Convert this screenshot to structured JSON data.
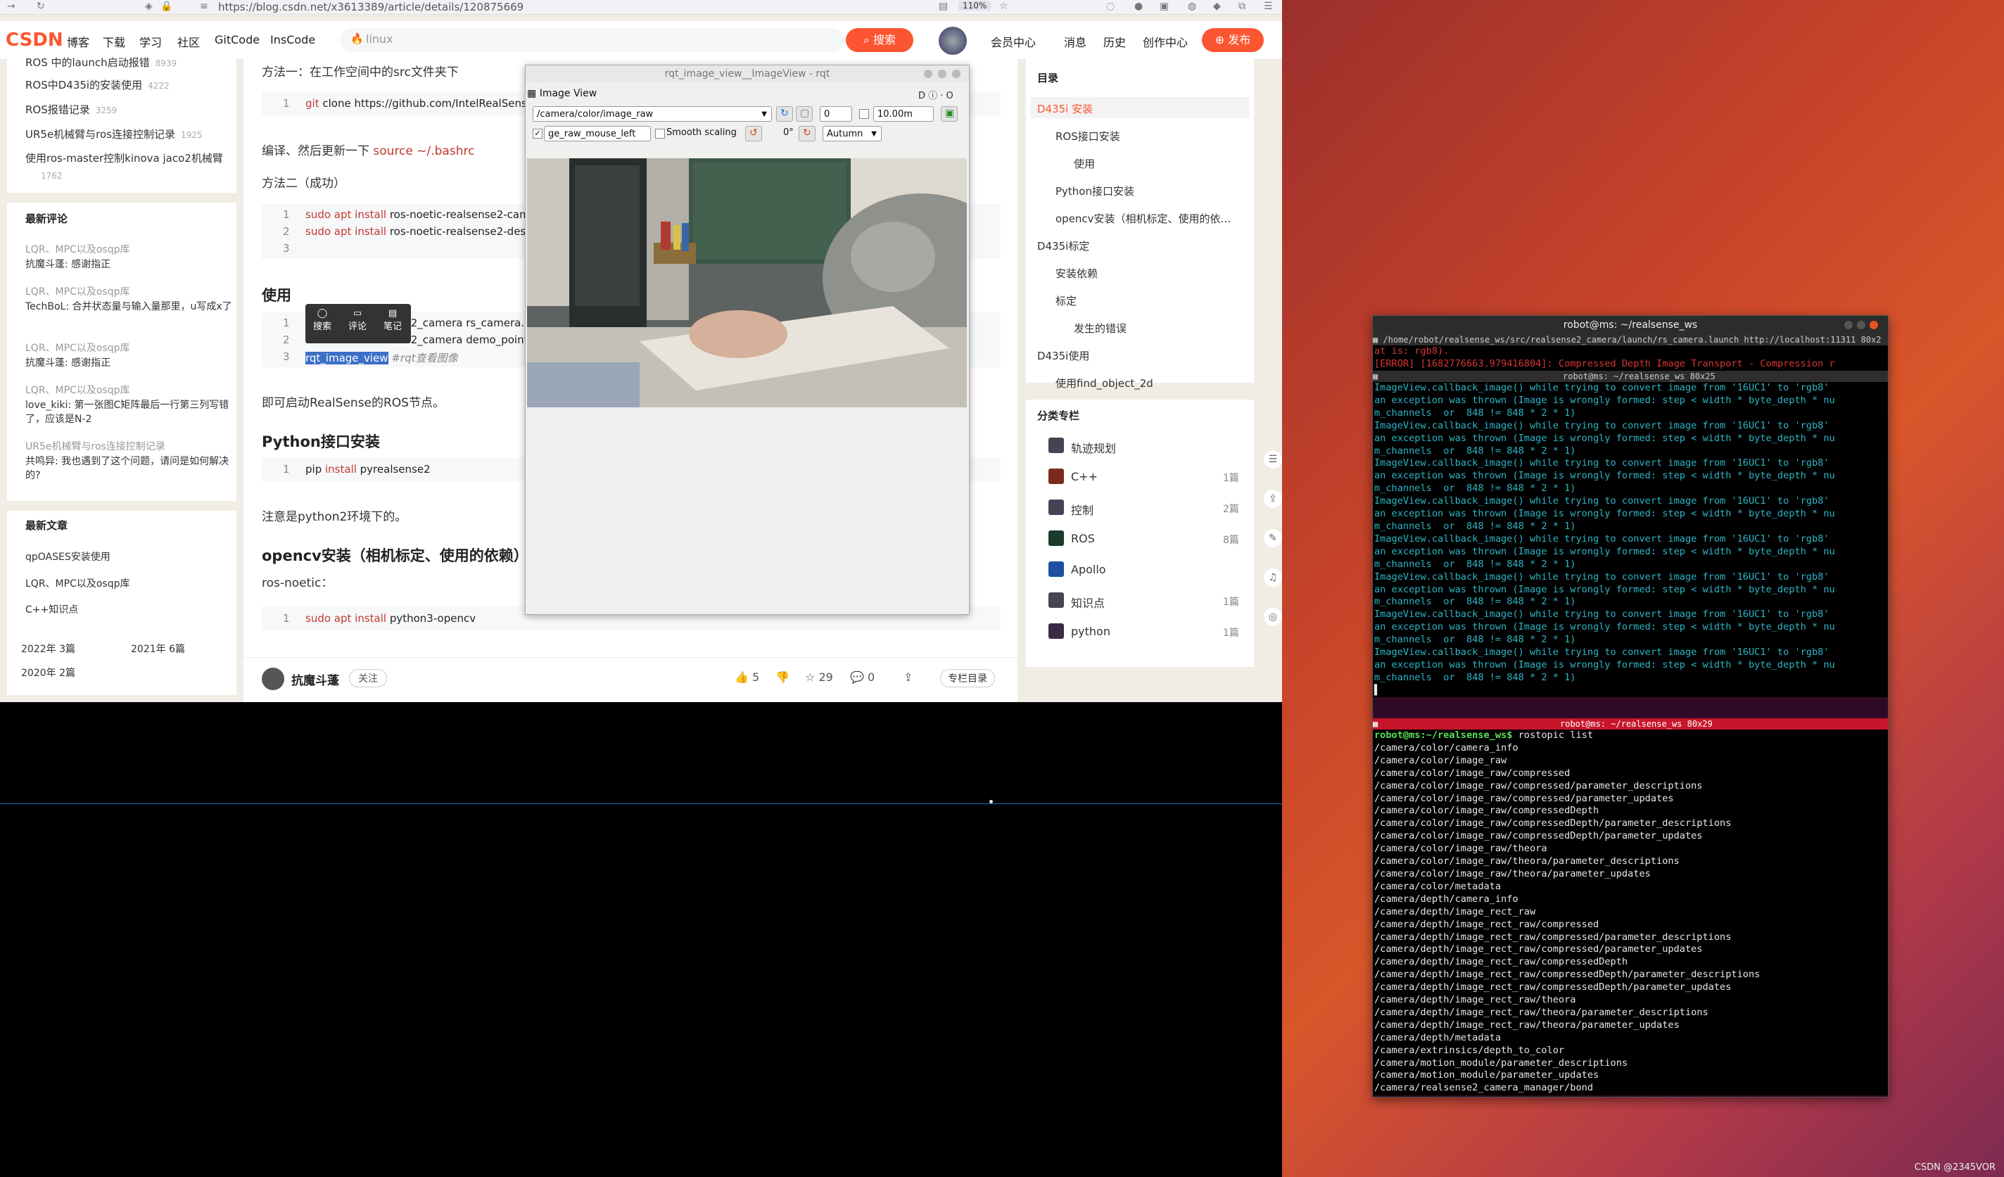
{
  "browser": {
    "url": "https://blog.csdn.net/x3613389/article/details/120875669",
    "zoom": "110%"
  },
  "csdn_nav": {
    "logo": "CSDN",
    "items": [
      "博客",
      "下载",
      "学习",
      "社区",
      "GitCode",
      "InsCode"
    ],
    "search_placeholder": "linux",
    "search_button": "搜索",
    "right_items": [
      "会员中心",
      "消息",
      "历史",
      "创作中心"
    ],
    "publish_button": "发布"
  },
  "left_sidebar": {
    "articles": [
      {
        "title": "ROS 中的launch启动报错",
        "views": "8939"
      },
      {
        "title": "ROS中D435i的安装使用",
        "views": "4222"
      },
      {
        "title": "ROS报错记录",
        "views": "3259"
      },
      {
        "title": "UR5e机械臂与ros连接控制记录",
        "views": "1925"
      },
      {
        "title": "使用ros-master控制kinova jaco2机械臂",
        "views": "1762"
      }
    ],
    "recent_comments_title": "最新评论",
    "comments": [
      {
        "article": "LQR、MPC以及osqp库",
        "text": "抗魔斗蓬: 感谢指正"
      },
      {
        "article": "LQR、MPC以及osqp库",
        "text": "TechBoL: 合并状态量与输入量那里，u写成x了"
      },
      {
        "article": "LQR、MPC以及osqp库",
        "text": "抗魔斗蓬: 感谢指正"
      },
      {
        "article": "LQR、MPC以及osqp库",
        "text": "love_kiki: 第一张图C矩阵最后一行第三列写错了，应该是N-2"
      },
      {
        "article": "UR5e机械臂与ros连接控制记录",
        "text": "共鸣异: 我也遇到了这个问题，请问是如何解决的?"
      }
    ],
    "recent_articles_title": "最新文章",
    "recent_articles": [
      "qpOASES安装使用",
      "LQR、MPC以及osqp库",
      "C++知识点"
    ],
    "archive": [
      "2022年 3篇",
      "2021年 6篇",
      "2020年 2篇"
    ]
  },
  "article": {
    "method1": "方法一：在工作空间中的src文件夹下",
    "code1": {
      "ln": "1",
      "kw": "git",
      "rest": " clone https://github.com/IntelRealSense/"
    },
    "compile_note": "编译、然后更新一下",
    "source_cmd": "source ~/.bashrc",
    "method2": "方法二（成功）",
    "code2": [
      {
        "ln": "1",
        "kw": "sudo apt install",
        "rest": " ros-noetic-realsense2-camera"
      },
      {
        "ln": "2",
        "kw": "sudo apt install",
        "rest": " ros-noetic-realsense2-description"
      },
      {
        "ln": "3",
        "kw": "",
        "rest": ""
      }
    ],
    "use_heading": "使用",
    "code3": [
      {
        "ln": "1",
        "text": "roslaunch realsense2_camera rs_camera.launch"
      },
      {
        "ln": "2",
        "text": "roslaunch realsense2_camera demo_pointcloud.launch"
      },
      {
        "ln": "3",
        "text": "rqt_image_view",
        "comment": "#rqt查看图像"
      }
    ],
    "popup": [
      "搜索",
      "评论",
      "笔记"
    ],
    "start_note": "即可启动RealSense的ROS节点。",
    "python_heading": "Python接口安装",
    "code4": {
      "ln": "1",
      "pre": "pip ",
      "kw": "install",
      "rest": " pyrealsense2"
    },
    "python_note": "注意是python2环境下的。",
    "opencv_heading": "opencv安装（相机标定、使用的依赖）",
    "ros_noetic": "ros-noetic：",
    "code5": {
      "ln": "1",
      "kw": "sudo apt install",
      "rest": " python3-opencv"
    }
  },
  "footer": {
    "author": "抗魔斗蓬",
    "follow": "关注",
    "likes": "5",
    "stars": "29",
    "comments": "0",
    "column_toc": "专栏目录"
  },
  "toc": {
    "title": "目录",
    "items": [
      {
        "label": "D435i 安装",
        "level": 1,
        "active": true
      },
      {
        "label": "ROS接口安装",
        "level": 2
      },
      {
        "label": "使用",
        "level": 3
      },
      {
        "label": "Python接口安装",
        "level": 2
      },
      {
        "label": "opencv安装（相机标定、使用的依…",
        "level": 2
      },
      {
        "label": "D435i标定",
        "level": 1
      },
      {
        "label": "安装依赖",
        "level": 2
      },
      {
        "label": "标定",
        "level": 2
      },
      {
        "label": "发生的错误",
        "level": 3
      },
      {
        "label": "D435i使用",
        "level": 1
      },
      {
        "label": "使用find_object_2d",
        "level": 2
      }
    ],
    "category_title": "分类专栏",
    "categories": [
      {
        "name": "轨迹规划",
        "count": ""
      },
      {
        "name": "C++",
        "count": "1篇"
      },
      {
        "name": "控制",
        "count": "2篇"
      },
      {
        "name": "ROS",
        "count": "8篇"
      },
      {
        "name": "Apollo",
        "count": ""
      },
      {
        "name": "知识点",
        "count": "1篇"
      },
      {
        "name": "python",
        "count": "1篇"
      }
    ]
  },
  "rqt": {
    "window_title": "rqt_image_view__ImageView - rqt",
    "plugin_label": "Image View",
    "topic": "/camera/color/image_raw",
    "spin_value": "0",
    "max_value": "10.00m",
    "mouse_topic": "ge_raw_mouse_left",
    "smooth_label": "Smooth scaling",
    "rotation": "0°",
    "colormap": "Autumn"
  },
  "terminal": {
    "window_title": "robot@ms: ~/realsense_ws",
    "bar1": "/home/robot/realsense_ws/src/realsense2_camera/launch/rs_camera.launch http://localhost:11311 80x2",
    "pane1_lines": [
      "at is: rgb8).",
      "[ERROR] [1682776663.979416804]: Compressed Depth Image Transport - Compression r"
    ],
    "bar2": "robot@ms: ~/realsense_ws 80x25",
    "pane2_lines": [
      "ImageView.callback_image() while trying to convert image from '16UC1' to 'rgb8'",
      "an exception was thrown (Image is wrongly formed: step < width * byte_depth * nu",
      "m_channels  or  848 != 848 * 2 * 1)",
      "ImageView.callback_image() while trying to convert image from '16UC1' to 'rgb8'",
      "an exception was thrown (Image is wrongly formed: step < width * byte_depth * nu",
      "m_channels  or  848 != 848 * 2 * 1)",
      "ImageView.callback_image() while trying to convert image from '16UC1' to 'rgb8'",
      "an exception was thrown (Image is wrongly formed: step < width * byte_depth * nu",
      "m_channels  or  848 != 848 * 2 * 1)",
      "ImageView.callback_image() while trying to convert image from '16UC1' to 'rgb8'",
      "an exception was thrown (Image is wrongly formed: step < width * byte_depth * nu",
      "m_channels  or  848 != 848 * 2 * 1)",
      "ImageView.callback_image() while trying to convert image from '16UC1' to 'rgb8'",
      "an exception was thrown (Image is wrongly formed: step < width * byte_depth * nu",
      "m_channels  or  848 != 848 * 2 * 1)",
      "ImageView.callback_image() while trying to convert image from '16UC1' to 'rgb8'",
      "an exception was thrown (Image is wrongly formed: step < width * byte_depth * nu",
      "m_channels  or  848 != 848 * 2 * 1)",
      "ImageView.callback_image() while trying to convert image from '16UC1' to 'rgb8'",
      "an exception was thrown (Image is wrongly formed: step < width * byte_depth * nu",
      "m_channels  or  848 != 848 * 2 * 1)",
      "ImageView.callback_image() while trying to convert image from '16UC1' to 'rgb8'",
      "an exception was thrown (Image is wrongly formed: step < width * byte_depth * nu",
      "m_channels  or  848 != 848 * 2 * 1)"
    ],
    "bar3": "robot@ms: ~/realsense_ws 80x29",
    "prompt": "robot@ms:~/realsense_ws$",
    "command": " rostopic list",
    "topics": [
      "/camera/color/camera_info",
      "/camera/color/image_raw",
      "/camera/color/image_raw/compressed",
      "/camera/color/image_raw/compressed/parameter_descriptions",
      "/camera/color/image_raw/compressed/parameter_updates",
      "/camera/color/image_raw/compressedDepth",
      "/camera/color/image_raw/compressedDepth/parameter_descriptions",
      "/camera/color/image_raw/compressedDepth/parameter_updates",
      "/camera/color/image_raw/theora",
      "/camera/color/image_raw/theora/parameter_descriptions",
      "/camera/color/image_raw/theora/parameter_updates",
      "/camera/color/metadata",
      "/camera/depth/camera_info",
      "/camera/depth/image_rect_raw",
      "/camera/depth/image_rect_raw/compressed",
      "/camera/depth/image_rect_raw/compressed/parameter_descriptions",
      "/camera/depth/image_rect_raw/compressed/parameter_updates",
      "/camera/depth/image_rect_raw/compressedDepth",
      "/camera/depth/image_rect_raw/compressedDepth/parameter_descriptions",
      "/camera/depth/image_rect_raw/compressedDepth/parameter_updates",
      "/camera/depth/image_rect_raw/theora",
      "/camera/depth/image_rect_raw/theora/parameter_descriptions",
      "/camera/depth/image_rect_raw/theora/parameter_updates",
      "/camera/depth/metadata",
      "/camera/extrinsics/depth_to_color",
      "/camera/motion_module/parameter_descriptions",
      "/camera/motion_module/parameter_updates",
      "/camera/realsense2_camera_manager/bond"
    ]
  },
  "watermark": "CSDN @2345VOR",
  "colors": {
    "csdn_red": "#fc5531",
    "terminal_cyan": "#2db5c4",
    "terminal_error": "#d93434",
    "prompt_green": "#5ae05a"
  }
}
